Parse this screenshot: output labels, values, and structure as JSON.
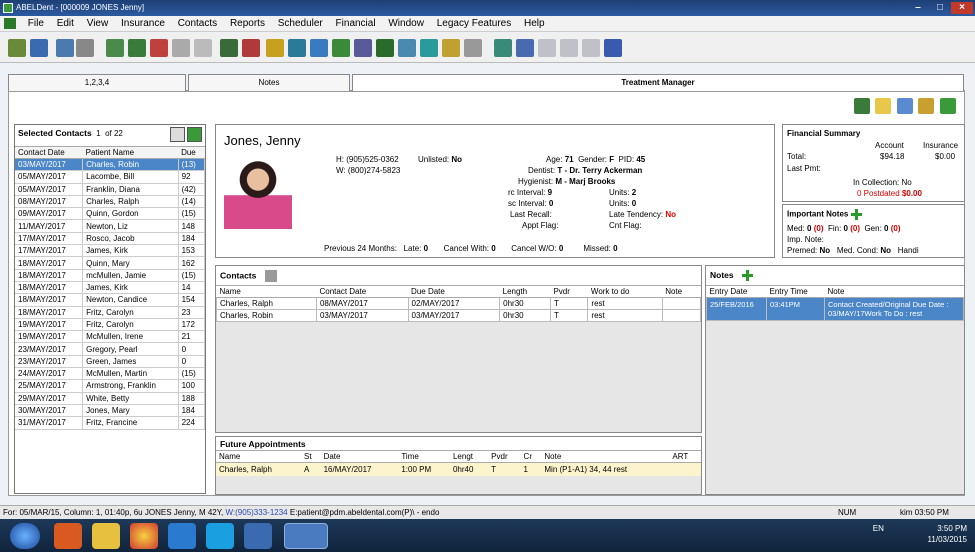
{
  "titlebar": {
    "title": "ABELDent - [000009 JONES Jenny]"
  },
  "menu": [
    "File",
    "Edit",
    "View",
    "Insurance",
    "Contacts",
    "Reports",
    "Scheduler",
    "Financial",
    "Window",
    "Legacy Features",
    "Help"
  ],
  "tabs": [
    "1,2,3,4",
    "Notes",
    "Treatment Manager"
  ],
  "contacts_list": {
    "title": "Selected Contacts",
    "index": "1",
    "of_label": "of",
    "total": "22",
    "headers": [
      "Contact Date",
      "Patient Name",
      "Due"
    ],
    "rows": [
      [
        "03/MAY/2017",
        "Charles, Robin",
        "(13)"
      ],
      [
        "05/MAY/2017",
        "Lacombe, Bill",
        "92"
      ],
      [
        "05/MAY/2017",
        "Franklin, Diana",
        "(42)"
      ],
      [
        "08/MAY/2017",
        "Charles, Ralph",
        "(14)"
      ],
      [
        "09/MAY/2017",
        "Quinn, Gordon",
        "(15)"
      ],
      [
        "11/MAY/2017",
        "Newton, Liz",
        "148"
      ],
      [
        "17/MAY/2017",
        "Rosco, Jacob",
        "184"
      ],
      [
        "17/MAY/2017",
        "James, Kirk",
        "153"
      ],
      [
        "18/MAY/2017",
        "Quinn, Mary",
        "162"
      ],
      [
        "18/MAY/2017",
        "mcMullen, Jamie",
        "(15)"
      ],
      [
        "18/MAY/2017",
        "James, Kirk",
        "14"
      ],
      [
        "18/MAY/2017",
        "Newton, Candice",
        "154"
      ],
      [
        "18/MAY/2017",
        "Fritz, Carolyn",
        "23"
      ],
      [
        "19/MAY/2017",
        "Fritz, Carolyn",
        "172"
      ],
      [
        "19/MAY/2017",
        "McMullen, Irene",
        "21"
      ],
      [
        "23/MAY/2017",
        "Gregory, Pearl",
        "0"
      ],
      [
        "23/MAY/2017",
        "Green, James",
        "0"
      ],
      [
        "24/MAY/2017",
        "McMullen, Martin",
        "(15)"
      ],
      [
        "25/MAY/2017",
        "Armstrong, Franklin",
        "100"
      ],
      [
        "29/MAY/2017",
        "White, Betty",
        "188"
      ],
      [
        "30/MAY/2017",
        "Jones, Mary",
        "184"
      ],
      [
        "31/MAY/2017",
        "Fritz, Francine",
        "224"
      ]
    ]
  },
  "patient": {
    "name": "Jones, Jenny",
    "home_phone": "H: (905)525-0362",
    "work_phone": "W: (800)274-5823",
    "unlisted_label": "Unlisted:",
    "unlisted": "No",
    "age_label": "Age:",
    "age": "71",
    "gender_label": "Gender:",
    "gender": "F",
    "pid_label": "PID:",
    "pid": "45",
    "dentist_label": "Dentist:",
    "dentist": "T - Dr. Terry Ackerman",
    "hygienist_label": "Hygienist:",
    "hygienist": "M - Marj Brooks",
    "rc_interval_label": "rc Interval:",
    "rc_interval": "9",
    "units1_label": "Units:",
    "units1": "2",
    "sc_interval_label": "sc Interval:",
    "sc_interval": "0",
    "units2_label": "Units:",
    "units2": "0",
    "last_recall_label": "Last Recall:",
    "late_tendency_label": "Late Tendency:",
    "late_tendency": "No",
    "appt_flag_label": "Appt Flag:",
    "cnt_flag_label": "Cnt Flag:",
    "prev_label": "Previous 24 Months:",
    "late_label": "Late:",
    "late": "0",
    "cancel_with_label": "Cancel With:",
    "cancel_with": "0",
    "cancel_wo_label": "Cancel W/O:",
    "cancel_wo": "0",
    "missed_label": "Missed:",
    "missed": "0"
  },
  "financial": {
    "title": "Financial Summary",
    "account_label": "Account",
    "insurance_label": "Insurance",
    "total_label": "Total:",
    "total_account": "$94.18",
    "total_insurance": "$0.00",
    "last_pmt_label": "Last Pmt:",
    "in_collection": "In Collection: No",
    "postdated": "0 Postdated",
    "postdated_amount": "$0.00"
  },
  "important_notes": {
    "title": "Important Notes",
    "med_label": "Med:",
    "med": "0",
    "med_count": "(0)",
    "fin_label": "Fin:",
    "fin": "0",
    "fin_count": "(0)",
    "gen_label": "Gen:",
    "gen": "0",
    "gen_count": "(0)",
    "imp_note_label": "Imp. Note:",
    "premed_label": "Premed:",
    "premed": "No",
    "med_cond_label": "Med. Cond:",
    "med_cond": "No",
    "handi_label": "Handi"
  },
  "contacts": {
    "title": "Contacts",
    "headers": [
      "Name",
      "Contact Date",
      "Due Date",
      "Length",
      "Pvdr",
      "Work to do",
      "Note"
    ],
    "rows": [
      [
        "Charles, Ralph",
        "08/MAY/2017",
        "02/MAY/2017",
        "0hr30",
        "T",
        "rest",
        ""
      ],
      [
        "Charles, Robin",
        "03/MAY/2017",
        "03/MAY/2017",
        "0hr30",
        "T",
        "rest",
        ""
      ]
    ]
  },
  "notes": {
    "title": "Notes",
    "headers": [
      "Entry Date",
      "Entry Time",
      "Note"
    ],
    "rows": [
      [
        "25/FEB/2016",
        "03:41PM",
        "Contact Created/Original Due Date : 03/MAY/17Work To Do : rest"
      ]
    ]
  },
  "future": {
    "title": "Future Appointments",
    "headers": [
      "Name",
      "St",
      "Date",
      "Time",
      "Lengt",
      "Pvdr",
      "Cr",
      "Note",
      "ART"
    ],
    "rows": [
      [
        "Charles, Ralph",
        "A",
        "16/MAY/2017",
        "1:00 PM",
        "0hr40",
        "T",
        "1",
        "Min (P1-A1) 34, 44 rest",
        ""
      ]
    ]
  },
  "status": {
    "text": "For: 05/MAR/15, Column: 1, 01:40p, 6u JONES Jenny, M 42Y,",
    "phone": "W:(905)333-1234",
    "email": "E:patient@pdm.abeldental.com(P)\\ - endo",
    "num": "NUM",
    "clock": "kim 03:50 PM"
  },
  "tray": {
    "lang": "EN",
    "time": "3:50 PM",
    "date": "11/03/2015"
  }
}
